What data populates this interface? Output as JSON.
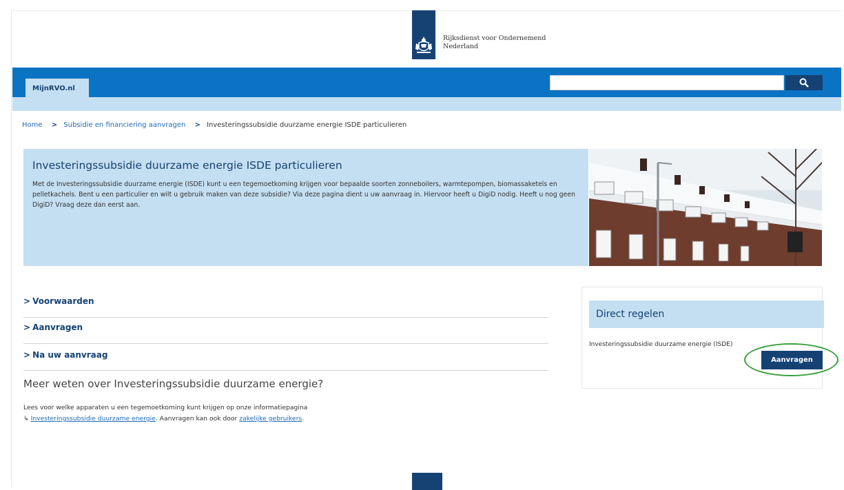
{
  "header": {
    "org_line1": "Rijksdienst voor Ondernemend",
    "org_line2": "Nederland",
    "logo_icon": "coat-of-arms-icon"
  },
  "nav": {
    "tab_label": "MijnRVO.nl",
    "search_placeholder": "",
    "search_icon": "search-icon"
  },
  "breadcrumb": {
    "home": "Home",
    "sep": ">",
    "item1": "Subsidie en financiering aanvragen",
    "current": "Investeringssubsidie duurzame energie ISDE particulieren"
  },
  "hero": {
    "title": "Investeringssubsidie duurzame energie ISDE particulieren",
    "body": "Met de Investeringssubsidie duurzame energie (ISDE) kunt u een tegemoetkoming krijgen voor bepaalde soorten zonneboilers, warmtepompen, biomassaketels en pelletkachels. Bent u een particulier en wilt u gebruik maken van deze subsidie? Via deze pagina dient u uw aanvraag in. Hiervoor heeft u DigiD nodig. Heeft u nog geen DigiD? Vraag deze dan eerst aan."
  },
  "sections": {
    "chevron": ">",
    "s1": "Voorwaarden",
    "s2": "Aanvragen",
    "s3": "Na uw aanvraag"
  },
  "more": {
    "heading": "Meer weten over Investeringssubsidie duurzame energie?",
    "line1": "Lees voor welke apparaten u een tegemoetkoming kunt krijgen op onze informatiepagina",
    "link_arrow": "↳",
    "link1": "Investeringssubsidie duurzame energie",
    "mid": ". Aanvragen kan ook door ",
    "link2": "zakelijke gebruikers",
    "end": "."
  },
  "panel": {
    "title": "Direct regelen",
    "text": "Investeringssubsidie duurzame energie (ISDE)",
    "button": "Aanvragen"
  },
  "colors": {
    "navy": "#154273",
    "blue": "#0b73c4",
    "light_blue": "#c5dff2",
    "highlight_ring": "#3a9e3a"
  }
}
